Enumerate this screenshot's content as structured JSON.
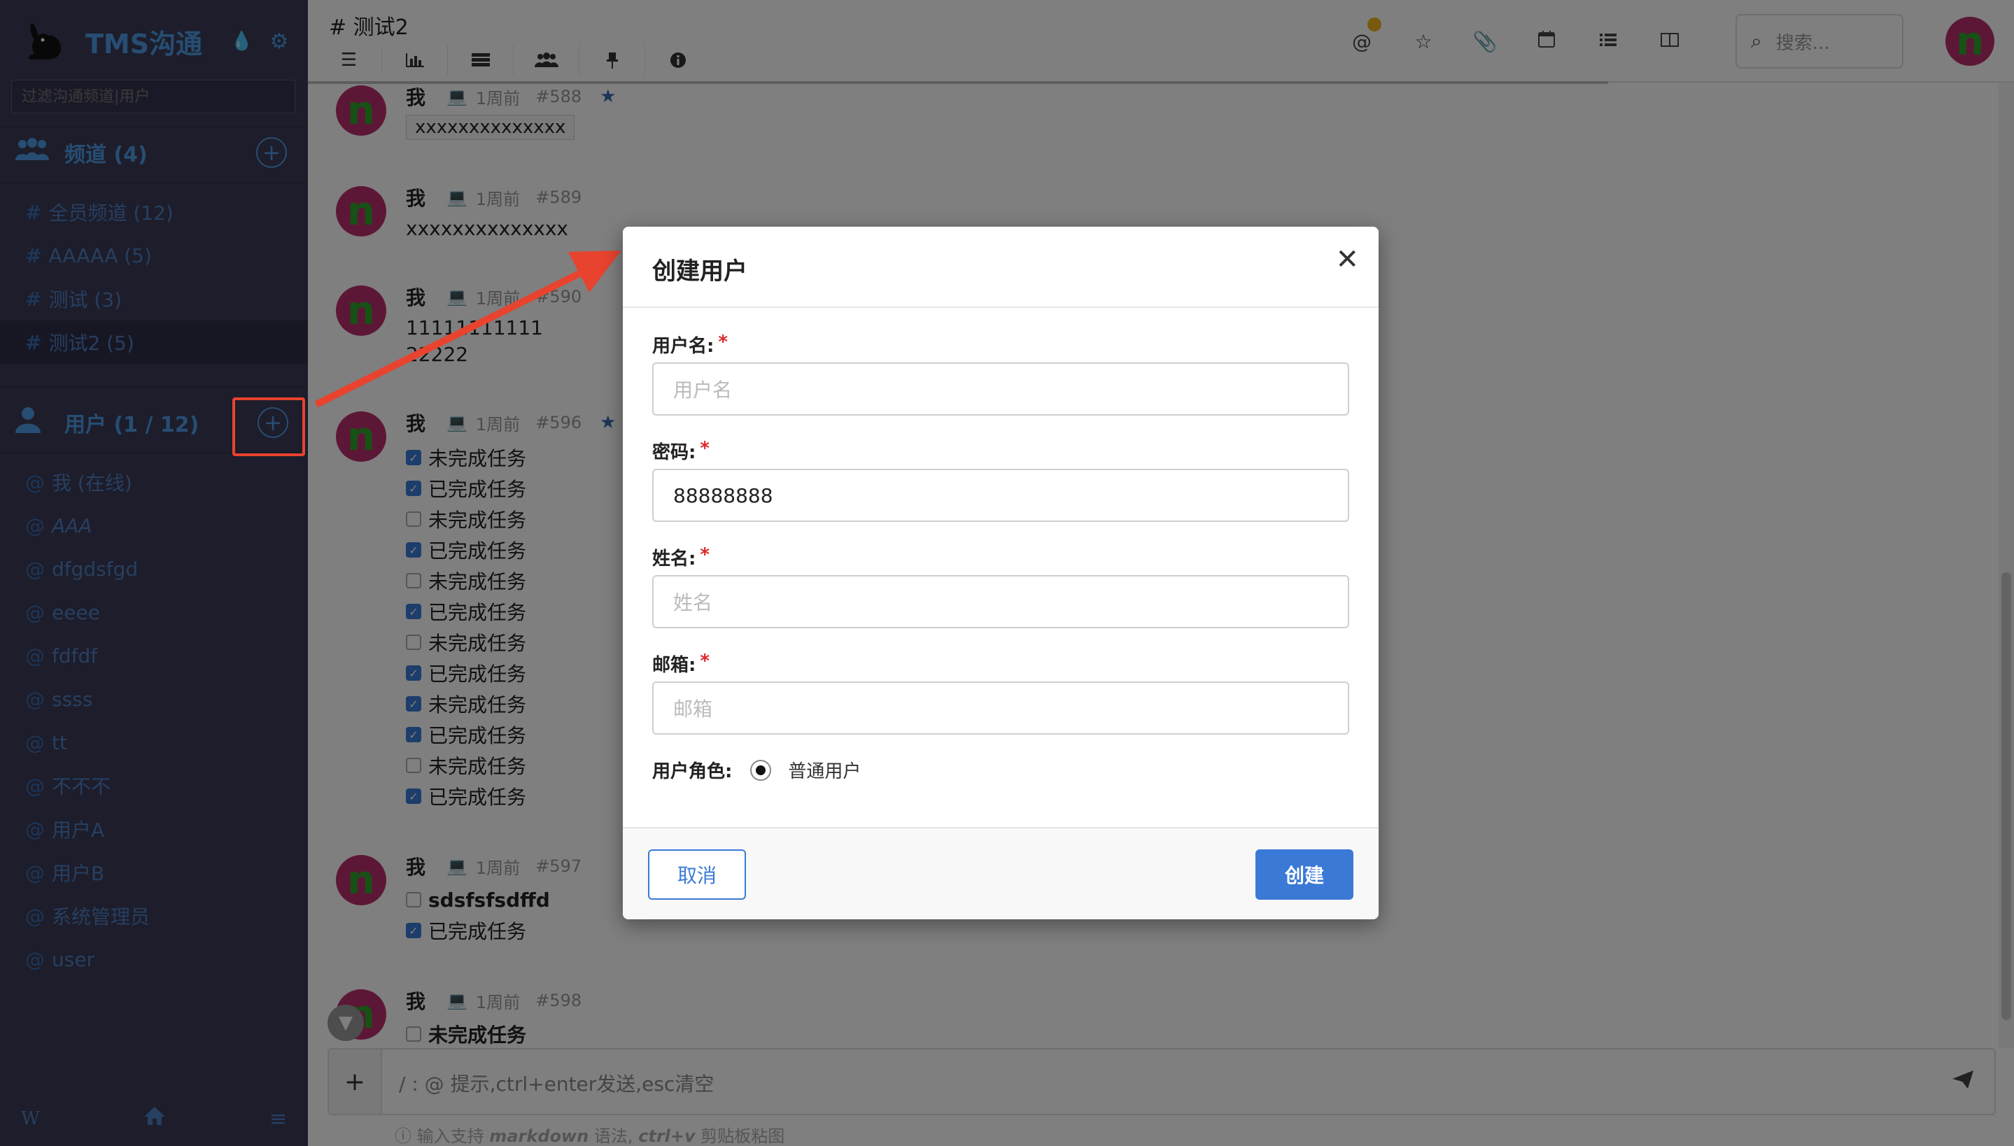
{
  "app": {
    "title": "TMS沟通"
  },
  "sidebar": {
    "filter_placeholder": "过滤沟通频道|用户",
    "channels_header": "频道 (4)",
    "channels": [
      {
        "label": "全员频道 (12)"
      },
      {
        "label": "AAAAA (5)"
      },
      {
        "label": "测试 (3)"
      },
      {
        "label": "测试2 (5)"
      }
    ],
    "users_header": "用户 (1 / 12)",
    "users": [
      {
        "label": "我 (在线)"
      },
      {
        "label": "AAA"
      },
      {
        "label": "dfgdsfgd"
      },
      {
        "label": "eeee"
      },
      {
        "label": "fdfdf"
      },
      {
        "label": "ssss"
      },
      {
        "label": "tt"
      },
      {
        "label": "不不不"
      },
      {
        "label": "用户A"
      },
      {
        "label": "用户B"
      },
      {
        "label": "系统管理员"
      },
      {
        "label": "user"
      }
    ],
    "footer_w": "W"
  },
  "header": {
    "channel_title": "# 测试2",
    "search_placeholder": "搜索...",
    "avatar_letter": "n"
  },
  "messages": [
    {
      "author": "我",
      "time": "1周前",
      "id": "#588",
      "starred": true,
      "body": "xxxxxxxxxxxxxx"
    },
    {
      "author": "我",
      "time": "1周前",
      "id": "#589",
      "body": "xxxxxxxxxxxxxx"
    },
    {
      "author": "我",
      "time": "1周前",
      "id": "#590",
      "line1": "11111111111",
      "line2": "22222"
    },
    {
      "author": "我",
      "time": "1周前",
      "id": "#596",
      "starred": true,
      "tasks": [
        {
          "text": "未完成任务",
          "done": true
        },
        {
          "text": "已完成任务",
          "done": true
        },
        {
          "text": "未完成任务",
          "done": false
        },
        {
          "text": "已完成任务",
          "done": true
        },
        {
          "text": "未完成任务",
          "done": false
        },
        {
          "text": "已完成任务",
          "done": true
        },
        {
          "text": "未完成任务",
          "done": false
        },
        {
          "text": "已完成任务",
          "done": true
        },
        {
          "text": "未完成任务",
          "done": true
        },
        {
          "text": "已完成任务",
          "done": true
        },
        {
          "text": "未完成任务",
          "done": false
        },
        {
          "text": "已完成任务",
          "done": true
        }
      ]
    },
    {
      "author": "我",
      "time": "1周前",
      "id": "#597",
      "tasks": [
        {
          "text": "sdsfsfsdffd",
          "done": false
        },
        {
          "text": "已完成任务",
          "done": true
        }
      ]
    },
    {
      "author": "我",
      "time": "1周前",
      "id": "#598",
      "tasks": [
        {
          "text": "未完成任务",
          "done": false
        }
      ]
    }
  ],
  "composer": {
    "placeholder": "/ : @ 提示,ctrl+enter发送,esc清空",
    "hint_prefix": "输入支持",
    "hint_markdown": "markdown",
    "hint_middle": "语法,",
    "hint_ctrlv": "ctrl+v",
    "hint_suffix": "剪贴板粘图"
  },
  "modal": {
    "title": "创建用户",
    "username_label": "用户名:",
    "username_placeholder": "用户名",
    "password_label": "密码:",
    "password_value": "88888888",
    "name_label": "姓名:",
    "name_placeholder": "姓名",
    "email_label": "邮箱:",
    "email_placeholder": "邮箱",
    "role_label": "用户角色:",
    "role_option": "普通用户",
    "cancel_label": "取消",
    "create_label": "创建"
  },
  "colors": {
    "accent": "#3a7ad6",
    "annotation": "#e8432f",
    "avatar_bg": "#bb2f6c",
    "avatar_letter": "#2da52a"
  }
}
